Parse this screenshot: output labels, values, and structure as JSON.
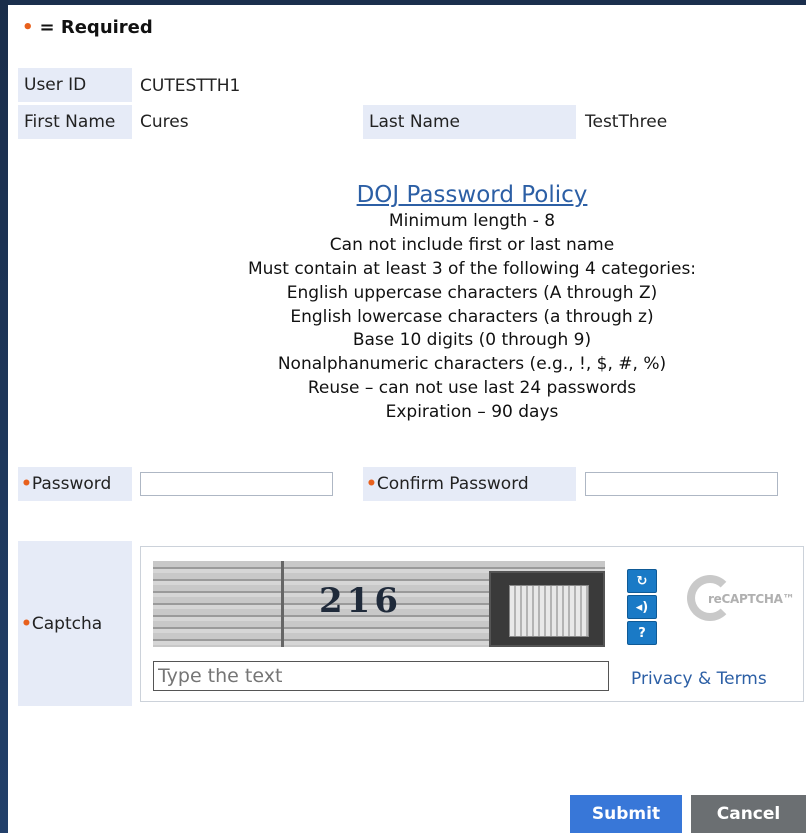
{
  "required_legend": {
    "bullet": "•",
    "text": "= Required"
  },
  "user_info": {
    "user_id_label": "User ID",
    "user_id_value": "CUTESTTH1",
    "first_name_label": "First Name",
    "first_name_value": "Cures",
    "last_name_label": "Last Name",
    "last_name_value": "TestThree"
  },
  "policy": {
    "link": "DOJ Password Policy",
    "lines": [
      "Minimum length - 8",
      "Can not include first or last name",
      "Must contain at least 3 of the following 4 categories:",
      "English uppercase characters (A through Z)",
      "English lowercase characters (a through z)",
      "Base 10 digits (0 through 9)",
      "Nonalphanumeric characters (e.g., !, $, #, %)",
      "Reuse – can not use last 24 passwords",
      "Expiration – 90 days"
    ]
  },
  "password": {
    "bullet": "•",
    "label": "Password",
    "value": "",
    "confirm_label": "Confirm Password",
    "confirm_value": ""
  },
  "captcha": {
    "bullet": "•",
    "label": "Captcha",
    "image_text": "216",
    "input_placeholder": "Type the text",
    "input_value": "",
    "logo_text": "reCAPTCHA™",
    "privacy_link": "Privacy & Terms",
    "icons": [
      "refresh-icon",
      "audio-icon",
      "help-icon"
    ]
  },
  "buttons": {
    "submit": "Submit",
    "cancel": "Cancel"
  },
  "colors": {
    "accent": "#e8601c",
    "link": "#2c5fa5",
    "label_bg": "#e6ebf7",
    "submit_bg": "#3877d8",
    "cancel_bg": "#6b6f72"
  }
}
